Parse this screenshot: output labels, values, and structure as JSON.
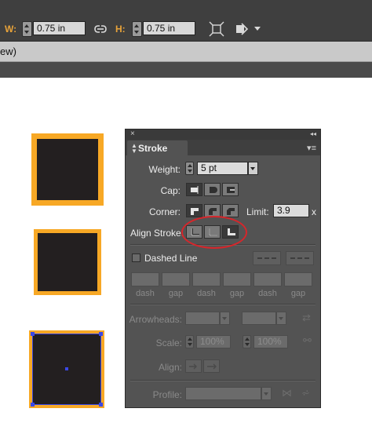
{
  "control_bar": {
    "width_label": "W:",
    "width_value": "0.75 in",
    "height_label": "H:",
    "height_value": "0.75 in",
    "icons": [
      "constrain-proportions-icon",
      "transform-each-icon",
      "isolate-object-icon"
    ]
  },
  "document_tab": {
    "text": "ew)"
  },
  "stroke_panel": {
    "close_glyph": "×",
    "collapse_glyph": "◂◂",
    "tab_title": "Stroke",
    "menu_glyph": "▾≡",
    "weight_label": "Weight:",
    "weight_value": "5 pt",
    "cap_label": "Cap:",
    "cap_buttons": [
      "butt-cap-icon",
      "round-cap-icon",
      "projecting-cap-icon"
    ],
    "cap_selected": "butt-cap-icon",
    "corner_label": "Corner:",
    "corner_buttons": [
      "miter-join-icon",
      "round-join-icon",
      "bevel-join-icon"
    ],
    "corner_selected": "miter-join-icon",
    "limit_label": "Limit:",
    "limit_value": "3.9",
    "limit_unit": "x",
    "align_label": "Align Stroke:",
    "align_buttons": [
      "align-center-icon",
      "align-inside-icon",
      "align-outside-icon"
    ],
    "align_selected": "align-outside-icon",
    "dashed_line_label": "Dashed Line",
    "dashed_line_checked": false,
    "dash_gap_labels": [
      "dash",
      "gap",
      "dash",
      "gap",
      "dash",
      "gap"
    ],
    "arrowheads_label": "Arrowheads:",
    "scale_label": "Scale:",
    "scale_start": "100%",
    "scale_end": "100%",
    "align_arrow_label": "Align:",
    "profile_label": "Profile:"
  },
  "colors": {
    "stroke_orange": "#f7a825",
    "fill_black": "#231f20",
    "selection_blue": "#3b48e6",
    "annotation_red": "#d6262b",
    "panel_gray": "#535353"
  }
}
